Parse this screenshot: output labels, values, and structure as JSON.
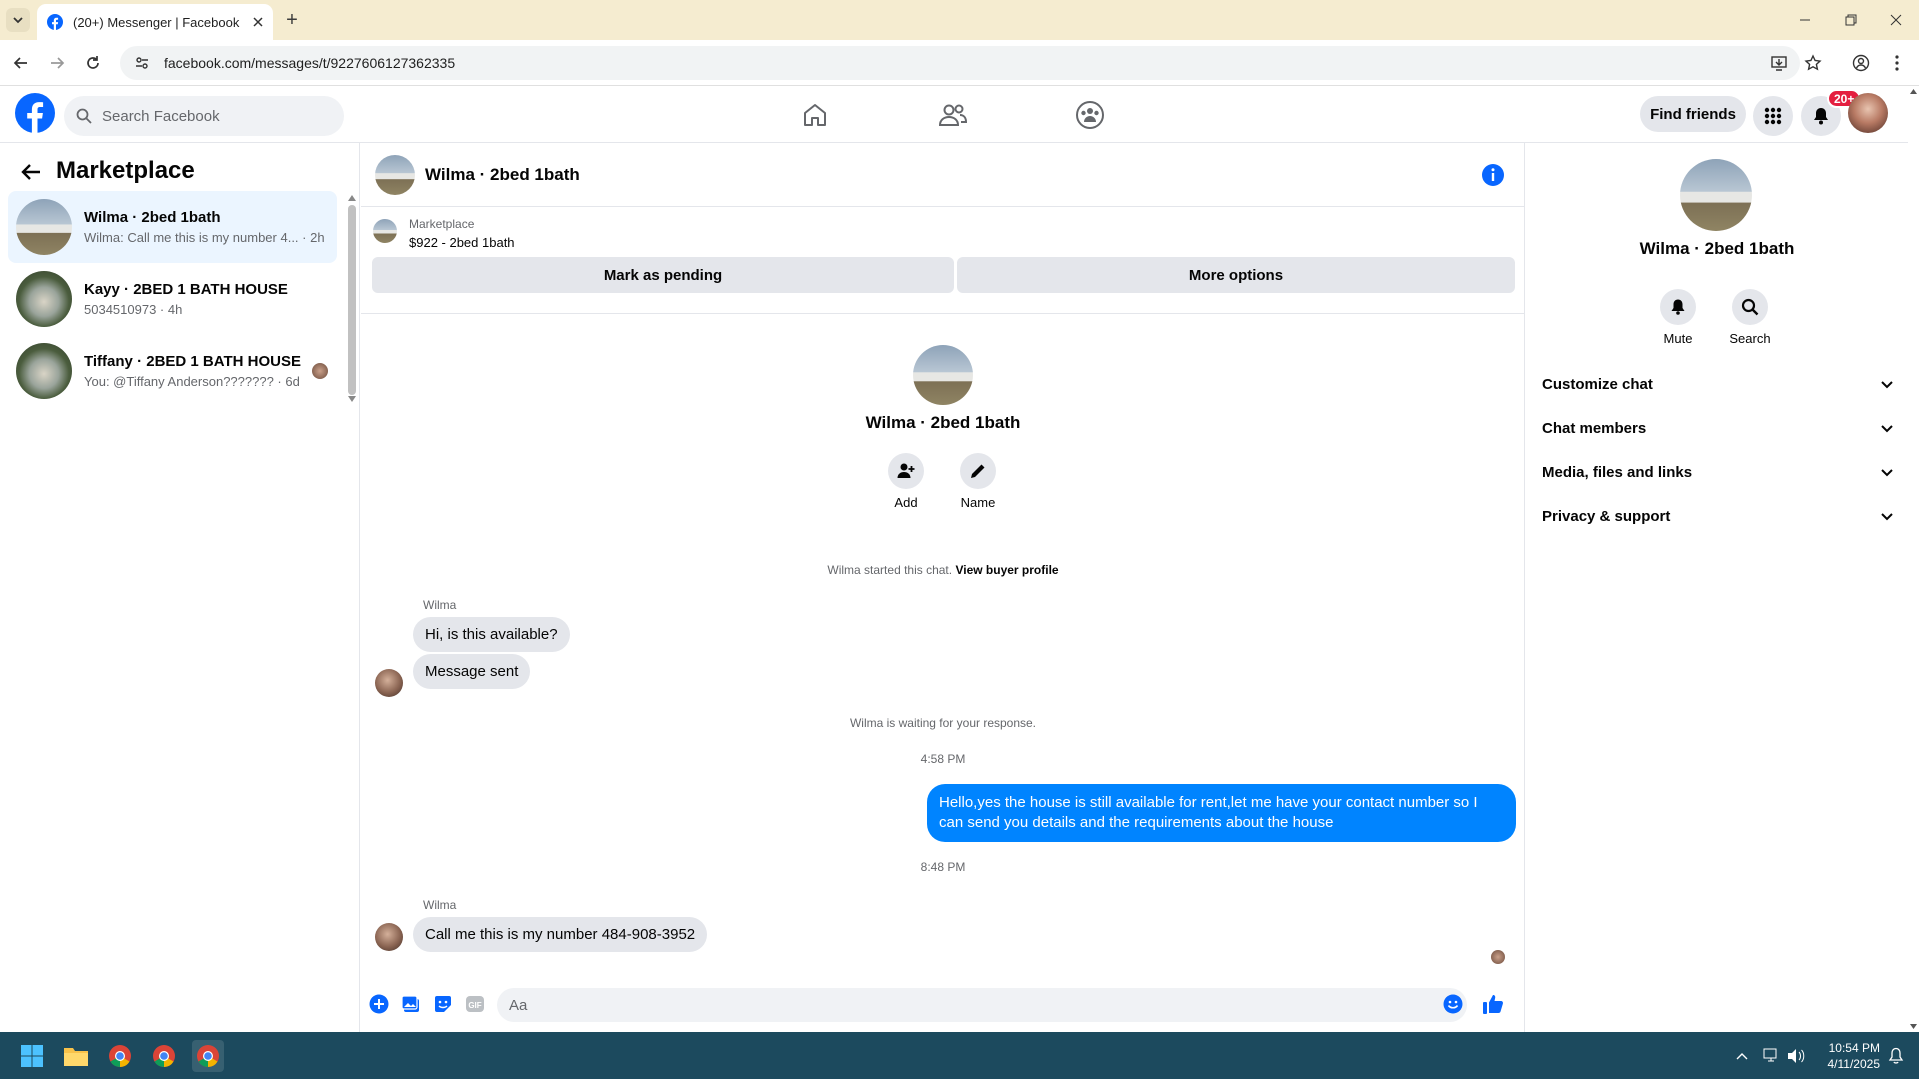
{
  "browser": {
    "tab_title": "(20+) Messenger | Facebook",
    "url": "facebook.com/messages/t/9227606127362335",
    "new_tab": "+"
  },
  "facebook": {
    "search_placeholder": "Search Facebook",
    "find_friends": "Find friends",
    "notification_badge": "20+"
  },
  "sidebar": {
    "title": "Marketplace",
    "conversations": [
      {
        "name": "Wilma · 2bed 1bath",
        "preview": "Wilma: Call me this is my number 4... · 2h"
      },
      {
        "name": "Kayy · 2BED 1 BATH HOUSE",
        "preview": "5034510973 · 4h"
      },
      {
        "name": "Tiffany · 2BED 1 BATH HOUSE",
        "preview": "You: @Tiffany Anderson??????? · 6d"
      }
    ]
  },
  "chat": {
    "title": "Wilma · 2bed 1bath",
    "marketplace_label": "Marketplace",
    "listing": "$922 - 2bed 1bath",
    "mark_pending": "Mark as pending",
    "more_options": "More options",
    "profile_name": "Wilma · 2bed 1bath",
    "add_label": "Add",
    "name_label": "Name",
    "started_text": "Wilma started this chat.",
    "view_buyer": "View buyer profile",
    "sender1": "Wilma",
    "msg1": "Hi, is this available?",
    "msg2": "Message sent",
    "waiting_text": "Wilma is waiting for your response.",
    "time1": "4:58 PM",
    "my_msg": "Hello,yes the house is still available for rent,let me have your contact number   so I can send you details and the requirements about the house",
    "time2": "8:48 PM",
    "sender2": "Wilma",
    "msg3": "Call me this is my number 484-908-3952",
    "input_placeholder": "Aa"
  },
  "details": {
    "name": "Wilma · 2bed 1bath",
    "mute": "Mute",
    "search": "Search",
    "sections": [
      "Customize chat",
      "Chat members",
      "Media, files and links",
      "Privacy & support"
    ]
  },
  "taskbar": {
    "time": "10:54 PM",
    "date": "4/11/2025"
  },
  "colors": {
    "accent": "#0084ff",
    "fb_blue": "#0866ff",
    "taskbar": "#1c4a5e",
    "tabstrip": "#f5ecd0"
  }
}
